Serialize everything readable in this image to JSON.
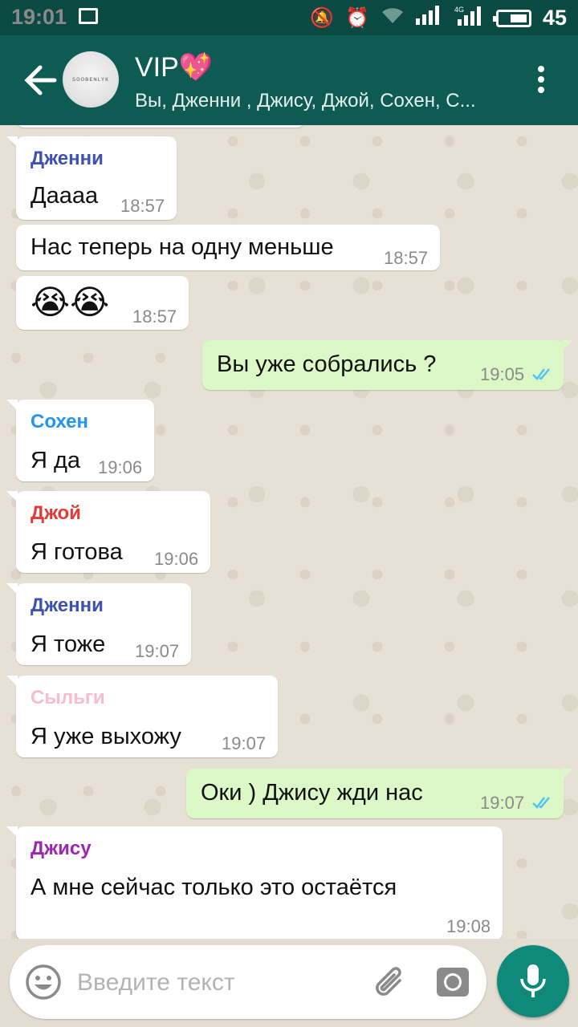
{
  "status_bar": {
    "time": "19:01",
    "network": "4G",
    "battery": "45"
  },
  "header": {
    "title": "VIP💖",
    "subtitle": "Вы, Дженни , Джису, Джой, Сохен, С...",
    "avatar_text": "ꜱᴏᴏʙᴇɴʟʏᴋ"
  },
  "messages": [
    {
      "sender": "Дженни",
      "sender_color": "#3f51b5",
      "text": "Даааа",
      "time": "18:57"
    },
    {
      "text": "Нас теперь на одну меньше",
      "time": "18:57"
    },
    {
      "text": "😭😭",
      "time": "18:57"
    },
    {
      "text": "Вы уже собрались ?",
      "time": "19:05",
      "outgoing": true
    },
    {
      "sender": "Сохен",
      "sender_color": "#2196f3",
      "text": "Я да",
      "time": "19:06"
    },
    {
      "sender": "Джой",
      "sender_color": "#e53935",
      "text": "Я готова",
      "time": "19:06"
    },
    {
      "sender": "Дженни",
      "sender_color": "#3f51b5",
      "text": "Я тоже",
      "time": "19:07"
    },
    {
      "sender": "Сыльги",
      "sender_color": "#f8bbd0",
      "text": "Я уже выхожу",
      "time": "19:07"
    },
    {
      "text": "Оки ) Джису жди нас",
      "time": "19:07",
      "outgoing": true
    },
    {
      "sender": "Джису",
      "sender_color": "#9c27b0",
      "text": "А мне сейчас только это остаётся",
      "time": "19:08"
    }
  ],
  "input": {
    "placeholder": "Введите текст"
  },
  "colors": {
    "header": "#0d5b52",
    "status_bar": "#0a4a42",
    "outgoing_bubble": "#dcf8c6",
    "mic": "#0f8a7a",
    "read_check": "#4fc3f7"
  }
}
